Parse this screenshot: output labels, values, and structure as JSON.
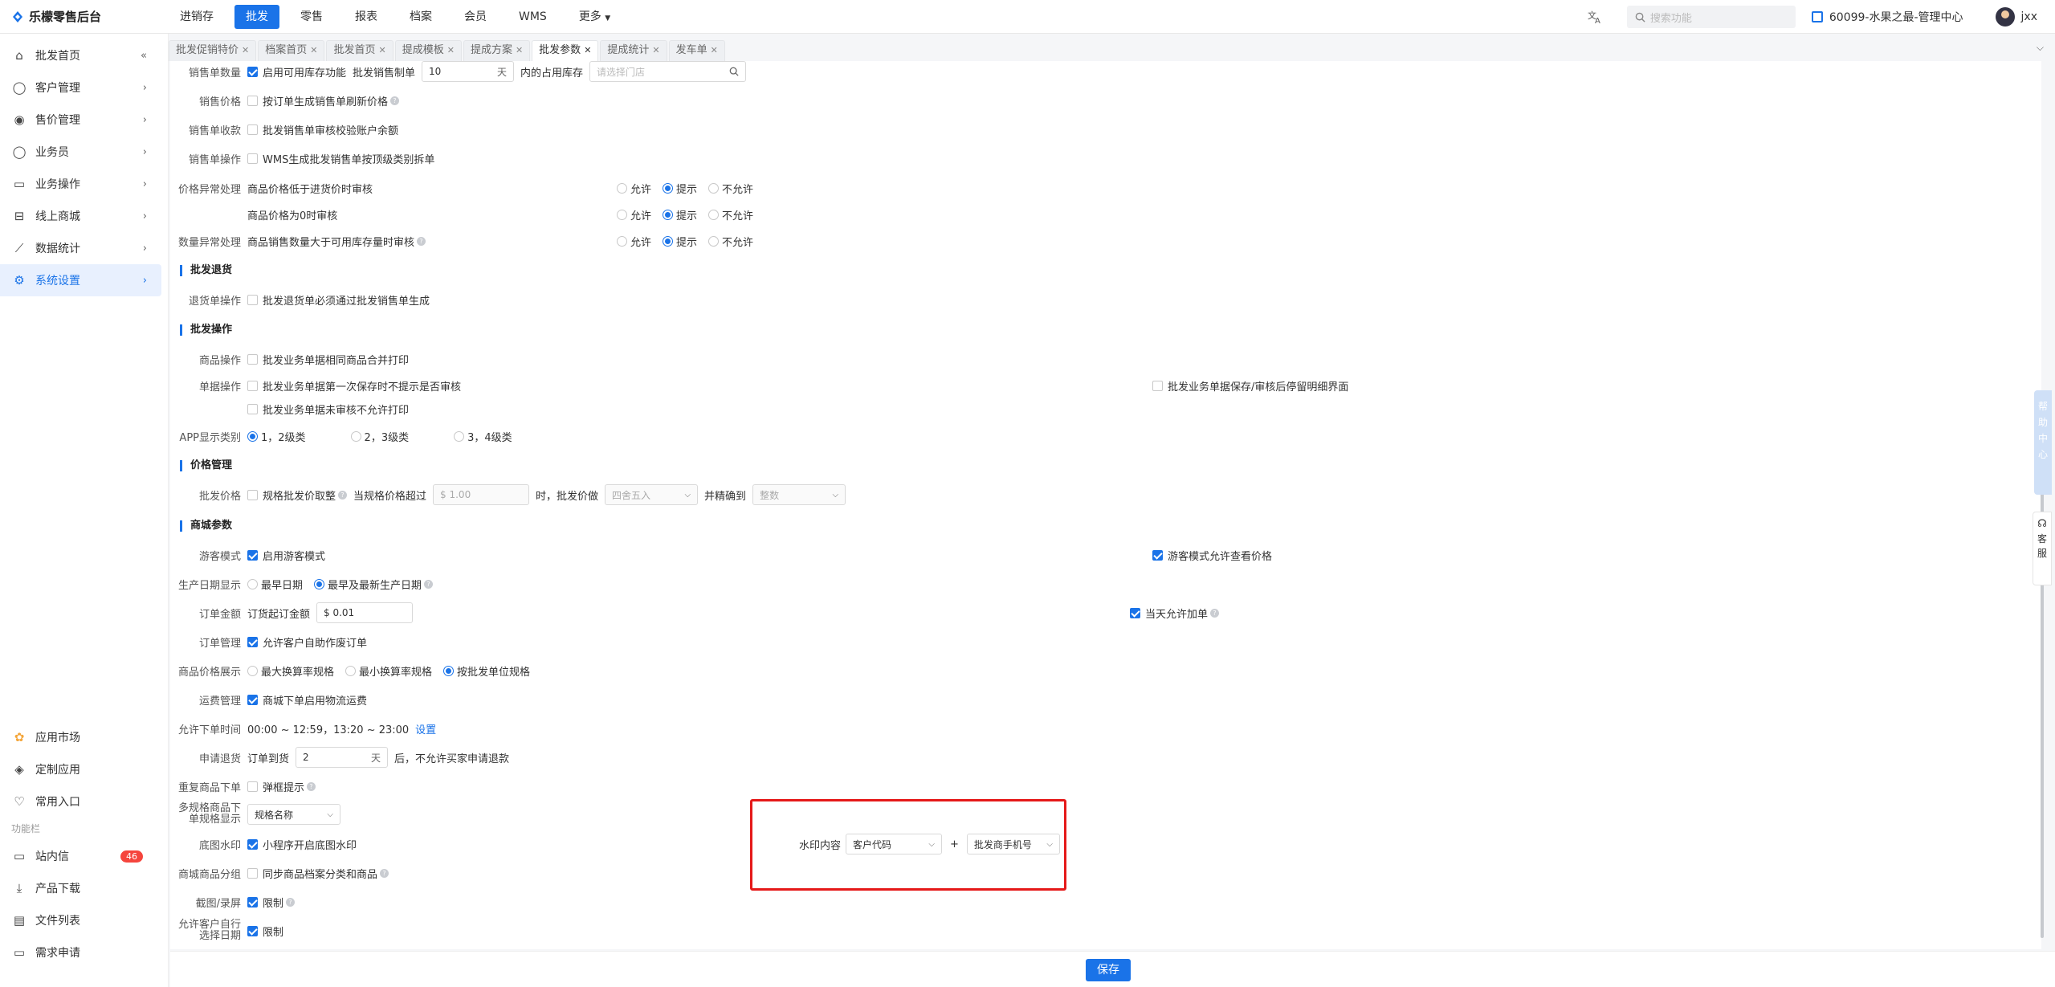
{
  "app": {
    "title": "乐檬零售后台"
  },
  "nav": [
    "进销存",
    "批发",
    "零售",
    "报表",
    "档案",
    "会员",
    "WMS",
    "更多"
  ],
  "nav_active": 1,
  "search": {
    "placeholder": "搜索功能"
  },
  "store": "60099-水果之最-管理中心",
  "user": "jxx",
  "sidebar": {
    "items": [
      {
        "label": "批发首页",
        "icon": "home-icon",
        "trail": "«"
      },
      {
        "label": "客户管理",
        "icon": "user-icon",
        "trail": "›"
      },
      {
        "label": "售价管理",
        "icon": "price-icon",
        "trail": "›"
      },
      {
        "label": "业务员",
        "icon": "person-icon",
        "trail": "›"
      },
      {
        "label": "业务操作",
        "icon": "operation-icon",
        "trail": "›"
      },
      {
        "label": "线上商城",
        "icon": "store-icon",
        "trail": "›"
      },
      {
        "label": "数据统计",
        "icon": "chart-icon",
        "trail": "›"
      },
      {
        "label": "系统设置",
        "icon": "gear-icon",
        "trail": "›"
      }
    ],
    "bottom": [
      {
        "label": "应用市场",
        "icon": "app-market-icon"
      },
      {
        "label": "定制应用",
        "icon": "custom-app-icon"
      },
      {
        "label": "常用入口",
        "icon": "heart-icon"
      }
    ],
    "func_label": "功能栏",
    "func": [
      {
        "label": "站内信",
        "icon": "message-icon",
        "badge": "46"
      },
      {
        "label": "产品下载",
        "icon": "download-icon"
      },
      {
        "label": "文件列表",
        "icon": "file-icon"
      },
      {
        "label": "需求申请",
        "icon": "request-icon"
      }
    ]
  },
  "tabs": [
    "批发促销特价",
    "档案首页",
    "批发首页",
    "提成模板",
    "提成方案",
    "批发参数",
    "提成统计",
    "发车单"
  ],
  "tab_active": 5,
  "form": {
    "r1": {
      "label": "销售单数量",
      "text1": "启用可用库存功能",
      "text2": "批发销售制单",
      "value": "10",
      "unit": "天",
      "text3": "内的占用库存",
      "placeholder": "请选择门店"
    },
    "r2": {
      "label": "销售价格",
      "text": "按订单生成销售单刷新价格"
    },
    "r3": {
      "label": "销售单收款",
      "text": "批发销售单审核校验账户余额"
    },
    "r4": {
      "label": "销售单操作",
      "text": "WMS生成批发销售单按顶级类别拆单"
    },
    "r5": {
      "label": "价格异常处理",
      "text": "商品价格低于进货价时审核"
    },
    "r6": {
      "text": "商品价格为0时审核"
    },
    "r7": {
      "label": "数量异常处理",
      "text": "商品销售数量大于可用库存量时审核"
    },
    "radio3": [
      "允许",
      "提示",
      "不允许"
    ],
    "sec_return": "批发退货",
    "r8": {
      "label": "退货单操作",
      "text": "批发退货单必须通过批发销售单生成"
    },
    "sec_op": "批发操作",
    "r9": {
      "label": "商品操作",
      "text": "批发业务单据相同商品合并打印"
    },
    "r10": {
      "label": "单据操作",
      "text": "批发业务单据第一次保存时不提示是否审核",
      "right": "批发业务单据保存/审核后停留明细界面"
    },
    "r11": {
      "text": "批发业务单据未审核不允许打印"
    },
    "r12": {
      "label": "APP显示类别",
      "options": [
        "1，2级类",
        "2，3级类",
        "3，4级类"
      ]
    },
    "sec_price": "价格管理",
    "r13": {
      "label": "批发价格",
      "text": "规格批发价取整",
      "t2": "当规格价格超过",
      "ph": "$ 1.00",
      "t3": "时，批发价做",
      "sel1": "四舍五入",
      "t4": "并精确到",
      "sel2": "整数"
    },
    "sec_mall": "商城参数",
    "r14": {
      "label": "游客模式",
      "text": "启用游客模式",
      "right": "游客模式允许查看价格"
    },
    "r15": {
      "label": "生产日期显示",
      "o1": "最早日期",
      "o2": "最早及最新生产日期"
    },
    "r16": {
      "label": "订单金额",
      "text": "订货起订金额",
      "value": "$ 0.01",
      "right": "当天允许加单"
    },
    "r17": {
      "label": "订单管理",
      "text": "允许客户自助作废订单"
    },
    "r18": {
      "label": "商品价格展示",
      "options": [
        "最大换算率规格",
        "最小换算率规格",
        "按批发单位规格"
      ]
    },
    "r19": {
      "label": "运费管理",
      "text": "商城下单启用物流运费"
    },
    "r20": {
      "label": "允许下单时间",
      "text": "00:00 ~ 12:59，13:20 ~ 23:00",
      "link": "设置"
    },
    "r21": {
      "label": "申请退货",
      "t1": "订单到货",
      "value": "2",
      "unit": "天",
      "t2": "后，不允许买家申请退款"
    },
    "r22": {
      "label": "重复商品下单",
      "text": "弹框提示"
    },
    "r23": {
      "label1": "多规格商品下",
      "label2": "单规格显示",
      "sel": "规格名称"
    },
    "r24": {
      "label": "底图水印",
      "text": "小程序开启底图水印",
      "wm_label": "水印内容",
      "sel1": "客户代码",
      "plus": "+",
      "sel2": "批发商手机号"
    },
    "r25": {
      "label": "商城商品分组",
      "text": "同步商品档案分类和商品"
    },
    "r26": {
      "label": "截图/录屏",
      "text": "限制"
    },
    "r27": {
      "label1": "允许客户自行",
      "label2": "选择日期",
      "text": "限制"
    }
  },
  "footer": {
    "save": "保存"
  },
  "float": {
    "help": [
      "帮",
      "助",
      "中",
      "心"
    ],
    "service": [
      "客",
      "服"
    ]
  }
}
